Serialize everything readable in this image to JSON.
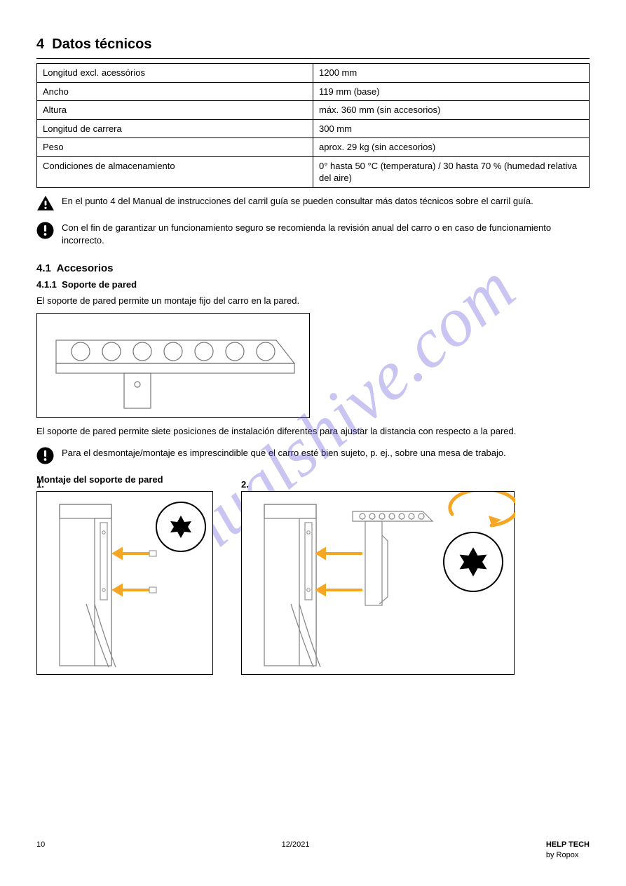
{
  "section": {
    "number": "4",
    "title": "Datos técnicos"
  },
  "spec_rows": [
    [
      "Longitud excl. acessórios",
      "1200 mm"
    ],
    [
      "Ancho",
      "119 mm (base)"
    ],
    [
      "Altura",
      "máx. 360 mm (sin accesorios)"
    ],
    [
      "Longitud de carrera",
      "300 mm"
    ],
    [
      "Peso",
      "aprox. 29 kg (sin accesorios)"
    ],
    [
      "Condiciones de almacenamiento",
      "0° hasta 50 °C (temperatura) / 30 hasta 70 % (humedad relativa del aire)"
    ]
  ],
  "warning_note": "En el punto 4 del Manual de instrucciones del carril guía se pueden consultar más datos técnicos sobre el carril guía.",
  "caution_note": "Con el fin de garantizar un funcionamiento seguro se recomienda la revisión anual del carro o en caso de funcionamiento incorrecto.",
  "subsection": {
    "number": "4.1",
    "title": "Accesorios",
    "subnumber": "4.1.1",
    "subtitle": "Soporte de pared"
  },
  "bracket_para1": "El soporte de pared permite un montaje fijo del carro en la pared.",
  "bracket_para2": "El soporte de pared permite siete posiciones de instalación diferentes para ajustar la distancia con respecto a la pared.",
  "mounting_note": "Para el desmontaje/montaje es imprescindible que el carro esté bien sujeto, p. ej., sobre una mesa de trabajo.",
  "mounting_heading": "Montaje del soporte de pared",
  "steps": {
    "s1": "1.",
    "s2": "2."
  },
  "watermark": "manualshive.com",
  "footer": {
    "page": "10",
    "center": "12/2021",
    "brand": "HELP TECH",
    "sub": "by Ropox"
  }
}
